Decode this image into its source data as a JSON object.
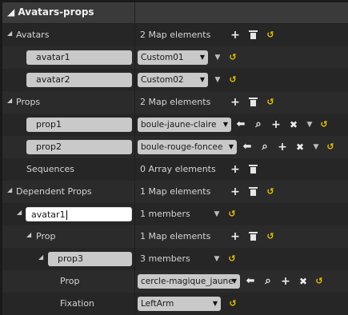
{
  "panel": {
    "title": "Avatars-props"
  },
  "rows": {
    "avatars": {
      "label": "Avatars",
      "value": "2 Map elements"
    },
    "avatar1": {
      "key": "avatar1",
      "value": "Custom01"
    },
    "avatar2": {
      "key": "avatar2",
      "value": "Custom02"
    },
    "props": {
      "label": "Props",
      "value": "2 Map elements"
    },
    "prop1": {
      "key": "prop1",
      "value": "boule-jaune-claire"
    },
    "prop2": {
      "key": "prop2",
      "value": "boule-rouge-foncee"
    },
    "sequences": {
      "label": "Sequences",
      "value": "0 Array elements"
    },
    "dependent_props": {
      "label": "Dependent Props",
      "value": "1 Map elements"
    },
    "dp_avatar1": {
      "key": "avatar1",
      "value": "1 members"
    },
    "dp_prop": {
      "label": "Prop",
      "value": "1 Map elements"
    },
    "dp_prop3": {
      "key": "prop3",
      "value": "3 members"
    },
    "dp_prop3_prop": {
      "label": "Prop",
      "value": "cercle-magique_jaune"
    },
    "fixation": {
      "label": "Fixation",
      "value": "LeftArm"
    }
  },
  "icons": {
    "collapse_arrow": "◢",
    "dropdown_arrow": "▼",
    "add": "+",
    "delete": "trash",
    "reset": "undo-arrow",
    "use_selected": "left-arrow",
    "browse": "magnifier",
    "clear": "x"
  },
  "colors": {
    "background": "#2b2b2b",
    "keybox": "#c9c9c9",
    "reset_arrow": "#e8c200"
  }
}
